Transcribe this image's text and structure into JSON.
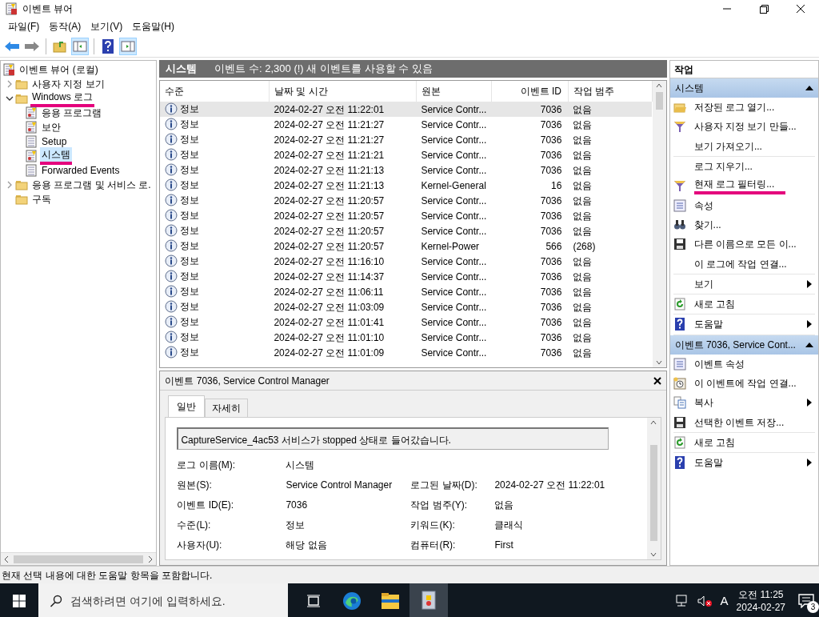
{
  "window": {
    "title": "이벤트 뷰어"
  },
  "menu": [
    "파일(F)",
    "동작(A)",
    "보기(V)",
    "도움말(H)"
  ],
  "toolbar": [
    [
      {
        "kind": "back",
        "pressed": false
      },
      {
        "kind": "forward",
        "pressed": false
      }
    ],
    [
      {
        "kind": "folder",
        "pressed": false
      },
      {
        "kind": "tree-pane",
        "pressed": true
      }
    ],
    [
      {
        "kind": "help",
        "pressed": false
      },
      {
        "kind": "action-pane",
        "pressed": true
      }
    ]
  ],
  "tree": [
    {
      "label": "이벤트 뷰어 (로컬)",
      "kind": "viewer",
      "selected": false,
      "highlighted": false,
      "children": [
        {
          "label": "사용자 지정 보기",
          "kind": "folder",
          "expanded": false,
          "selected": false,
          "highlighted": false
        },
        {
          "label": "Windows 로그",
          "kind": "folder",
          "expanded": true,
          "selected": false,
          "highlighted": true,
          "children": [
            {
              "label": "응용 프로그램",
              "kind": "log-warn",
              "selected": false,
              "highlighted": false
            },
            {
              "label": "보안",
              "kind": "log-warn",
              "selected": false,
              "highlighted": false
            },
            {
              "label": "Setup",
              "kind": "log",
              "selected": false,
              "highlighted": false
            },
            {
              "label": "시스템",
              "kind": "log-warn",
              "selected": true,
              "highlighted": true
            },
            {
              "label": "Forwarded Events",
              "kind": "log",
              "selected": false,
              "highlighted": false
            }
          ]
        },
        {
          "label": "응용 프로그램 및 서비스 로.",
          "kind": "folder",
          "expanded": false,
          "selected": false,
          "highlighted": false
        },
        {
          "label": "구독",
          "kind": "folder",
          "selected": false,
          "highlighted": false
        }
      ]
    }
  ],
  "log_panel": {
    "title": "시스템",
    "summary": "이벤트 수: 2,300 (!) 새 이벤트를 사용할 수 있음"
  },
  "table": {
    "columns": [
      "수준",
      "날짜 및 시간",
      "원본",
      "이벤트 ID",
      "작업 범주"
    ],
    "rows": [
      {
        "level": "정보",
        "date": "2024-02-27 오전 11:22:01",
        "source": "Service Contr...",
        "id": "7036",
        "category": "없음",
        "selected": true
      },
      {
        "level": "정보",
        "date": "2024-02-27 오전 11:21:27",
        "source": "Service Contr...",
        "id": "7036",
        "category": "없음",
        "selected": false
      },
      {
        "level": "정보",
        "date": "2024-02-27 오전 11:21:27",
        "source": "Service Contr...",
        "id": "7036",
        "category": "없음",
        "selected": false
      },
      {
        "level": "정보",
        "date": "2024-02-27 오전 11:21:21",
        "source": "Service Contr...",
        "id": "7036",
        "category": "없음",
        "selected": false
      },
      {
        "level": "정보",
        "date": "2024-02-27 오전 11:21:13",
        "source": "Service Contr...",
        "id": "7036",
        "category": "없음",
        "selected": false
      },
      {
        "level": "정보",
        "date": "2024-02-27 오전 11:21:13",
        "source": "Kernel-General",
        "id": "16",
        "category": "없음",
        "selected": false
      },
      {
        "level": "정보",
        "date": "2024-02-27 오전 11:20:57",
        "source": "Service Contr...",
        "id": "7036",
        "category": "없음",
        "selected": false
      },
      {
        "level": "정보",
        "date": "2024-02-27 오전 11:20:57",
        "source": "Service Contr...",
        "id": "7036",
        "category": "없음",
        "selected": false
      },
      {
        "level": "정보",
        "date": "2024-02-27 오전 11:20:57",
        "source": "Service Contr...",
        "id": "7036",
        "category": "없음",
        "selected": false
      },
      {
        "level": "정보",
        "date": "2024-02-27 오전 11:20:57",
        "source": "Kernel-Power",
        "id": "566",
        "category": "(268)",
        "selected": false
      },
      {
        "level": "정보",
        "date": "2024-02-27 오전 11:16:10",
        "source": "Service Contr...",
        "id": "7036",
        "category": "없음",
        "selected": false
      },
      {
        "level": "정보",
        "date": "2024-02-27 오전 11:14:37",
        "source": "Service Contr...",
        "id": "7036",
        "category": "없음",
        "selected": false
      },
      {
        "level": "정보",
        "date": "2024-02-27 오전 11:06:11",
        "source": "Service Contr...",
        "id": "7036",
        "category": "없음",
        "selected": false
      },
      {
        "level": "정보",
        "date": "2024-02-27 오전 11:03:09",
        "source": "Service Contr...",
        "id": "7036",
        "category": "없음",
        "selected": false
      },
      {
        "level": "정보",
        "date": "2024-02-27 오전 11:01:41",
        "source": "Service Contr...",
        "id": "7036",
        "category": "없음",
        "selected": false
      },
      {
        "level": "정보",
        "date": "2024-02-27 오전 11:01:10",
        "source": "Service Contr...",
        "id": "7036",
        "category": "없음",
        "selected": false
      },
      {
        "level": "정보",
        "date": "2024-02-27 오전 11:01:09",
        "source": "Service Contr...",
        "id": "7036",
        "category": "없음",
        "selected": false
      }
    ]
  },
  "detail": {
    "title": "이벤트 7036, Service Control Manager",
    "tabs": [
      {
        "label": "일반",
        "selected": true
      },
      {
        "label": "자세히",
        "selected": false
      }
    ],
    "message": "CaptureService_4ac53 서비스가 stopped 상태로 들어갔습니다.",
    "rows": [
      [
        {
          "label": "로그 이름(M):",
          "value": "시스템"
        }
      ],
      [
        {
          "label": "원본(S):",
          "value": "Service Control Manager"
        },
        {
          "label": "로그된 날짜(D):",
          "value": "2024-02-27 오전 11:22:01"
        }
      ],
      [
        {
          "label": "이벤트 ID(E):",
          "value": "7036"
        },
        {
          "label": "작업 범주(Y):",
          "value": "없음"
        }
      ],
      [
        {
          "label": "수준(L):",
          "value": "정보"
        },
        {
          "label": "키워드(K):",
          "value": "클래식"
        }
      ],
      [
        {
          "label": "사용자(U):",
          "value": "해당 없음"
        },
        {
          "label": "컴퓨터(R):",
          "value": "First"
        }
      ]
    ]
  },
  "actions": {
    "title": "작업",
    "sections": [
      {
        "title": "시스템",
        "expanded": true,
        "groups": [
          [
            {
              "label": "저장된 로그 열기...",
              "kind": "open",
              "submenu": false,
              "highlighted": false
            },
            {
              "label": "사용자 지정 보기 만들...",
              "kind": "filter",
              "submenu": false,
              "highlighted": false
            },
            {
              "label": "보기 가져오기...",
              "kind": "none",
              "submenu": false,
              "highlighted": false
            }
          ],
          [
            {
              "label": "로그 지우기...",
              "kind": "none",
              "submenu": false,
              "highlighted": false
            },
            {
              "label": "현재 로그 필터링...",
              "kind": "filter",
              "submenu": false,
              "highlighted": true
            },
            {
              "label": "속성",
              "kind": "properties",
              "submenu": false,
              "highlighted": false
            },
            {
              "label": "찾기...",
              "kind": "find",
              "submenu": false,
              "highlighted": false
            },
            {
              "label": "다른 이름으로 모든 이...",
              "kind": "save",
              "submenu": false,
              "highlighted": false
            },
            {
              "label": "이 로그에 작업 연결...",
              "kind": "none",
              "submenu": false,
              "highlighted": false
            }
          ],
          [
            {
              "label": "보기",
              "kind": "none",
              "submenu": true,
              "highlighted": false
            }
          ],
          [
            {
              "label": "새로 고침",
              "kind": "refresh",
              "submenu": false,
              "highlighted": false
            }
          ],
          [
            {
              "label": "도움말",
              "kind": "help",
              "submenu": true,
              "highlighted": false
            }
          ]
        ]
      },
      {
        "title": "이벤트 7036, Service Cont...",
        "expanded": true,
        "groups": [
          [
            {
              "label": "이벤트 속성",
              "kind": "properties",
              "submenu": false,
              "highlighted": false
            },
            {
              "label": "이 이벤트에 작업 연결...",
              "kind": "task",
              "submenu": false,
              "highlighted": false
            },
            {
              "label": "복사",
              "kind": "copy",
              "submenu": true,
              "highlighted": false
            },
            {
              "label": "선택한 이벤트 저장...",
              "kind": "save",
              "submenu": false,
              "highlighted": false
            }
          ],
          [
            {
              "label": "새로 고침",
              "kind": "refresh",
              "submenu": false,
              "highlighted": false
            }
          ],
          [
            {
              "label": "도움말",
              "kind": "help",
              "submenu": true,
              "highlighted": false
            }
          ]
        ]
      }
    ]
  },
  "status_bar": "현재 선택 내용에 대한 도움말 항목을 포함합니다.",
  "taskbar": {
    "search": {
      "placeholder": "검색하려면 여기에 입력하세요."
    },
    "apps": [
      {
        "kind": "task-view",
        "active": false
      },
      {
        "kind": "browser",
        "active": false
      },
      {
        "kind": "explorer",
        "active": false
      },
      {
        "kind": "event-viewer",
        "active": true
      }
    ],
    "ime": "A",
    "time": "오전 11:25",
    "date": "2024-02-27",
    "notifications": "3"
  }
}
